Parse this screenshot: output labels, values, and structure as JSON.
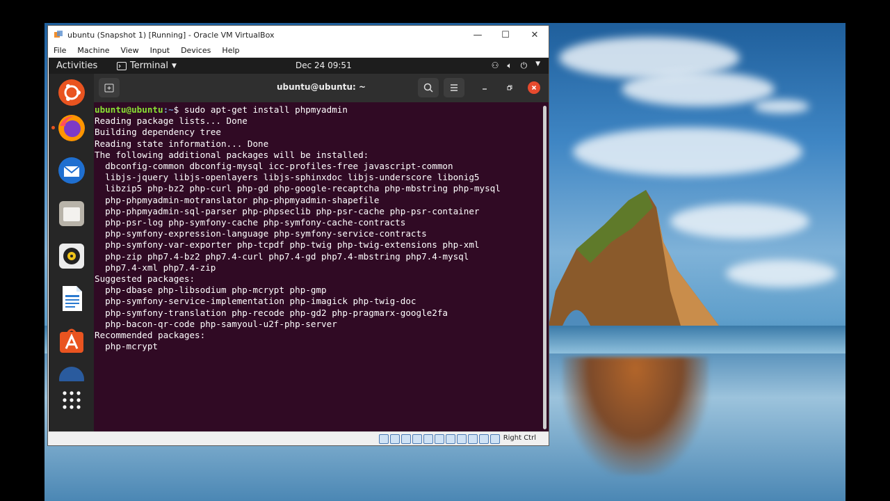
{
  "window": {
    "title": "ubuntu (Snapshot 1) [Running] - Oracle VM VirtualBox",
    "controls": {
      "minimize": "—",
      "maximize": "☐",
      "close": "✕"
    }
  },
  "menubar": [
    "File",
    "Machine",
    "View",
    "Input",
    "Devices",
    "Help"
  ],
  "gnome_topbar": {
    "activities": "Activities",
    "app_label": "Terminal",
    "clock": "Dec 24  09:51"
  },
  "dock": {
    "items": [
      "ubuntu-logo-icon",
      "firefox-icon",
      "thunderbird-icon",
      "files-icon",
      "rhythmbox-icon",
      "libreoffice-writer-icon",
      "ubuntu-software-icon",
      "help-icon",
      "show-applications-icon"
    ]
  },
  "terminal": {
    "title": "ubuntu@ubuntu: ~",
    "prompt_user": "ubuntu@ubuntu",
    "prompt_path": ":~",
    "prompt_symbol": "$ ",
    "command": "sudo apt-get install phpmyadmin",
    "output": [
      "Reading package lists... Done",
      "Building dependency tree",
      "Reading state information... Done",
      "The following additional packages will be installed:",
      "  dbconfig-common dbconfig-mysql icc-profiles-free javascript-common",
      "  libjs-jquery libjs-openlayers libjs-sphinxdoc libjs-underscore libonig5",
      "  libzip5 php-bz2 php-curl php-gd php-google-recaptcha php-mbstring php-mysql",
      "  php-phpmyadmin-motranslator php-phpmyadmin-shapefile",
      "  php-phpmyadmin-sql-parser php-phpseclib php-psr-cache php-psr-container",
      "  php-psr-log php-symfony-cache php-symfony-cache-contracts",
      "  php-symfony-expression-language php-symfony-service-contracts",
      "  php-symfony-var-exporter php-tcpdf php-twig php-twig-extensions php-xml",
      "  php-zip php7.4-bz2 php7.4-curl php7.4-gd php7.4-mbstring php7.4-mysql",
      "  php7.4-xml php7.4-zip",
      "Suggested packages:",
      "  php-dbase php-libsodium php-mcrypt php-gmp",
      "  php-symfony-service-implementation php-imagick php-twig-doc",
      "  php-symfony-translation php-recode php-gd2 php-pragmarx-google2fa",
      "  php-bacon-qr-code php-samyoul-u2f-php-server",
      "Recommended packages:",
      "  php-mcrypt"
    ]
  },
  "statusbar": {
    "host_key": "Right Ctrl"
  },
  "colors": {
    "terminal_bg": "#300a24",
    "ubuntu_orange": "#e95420",
    "prompt_green": "#8ae234",
    "prompt_blue": "#729fcf"
  }
}
